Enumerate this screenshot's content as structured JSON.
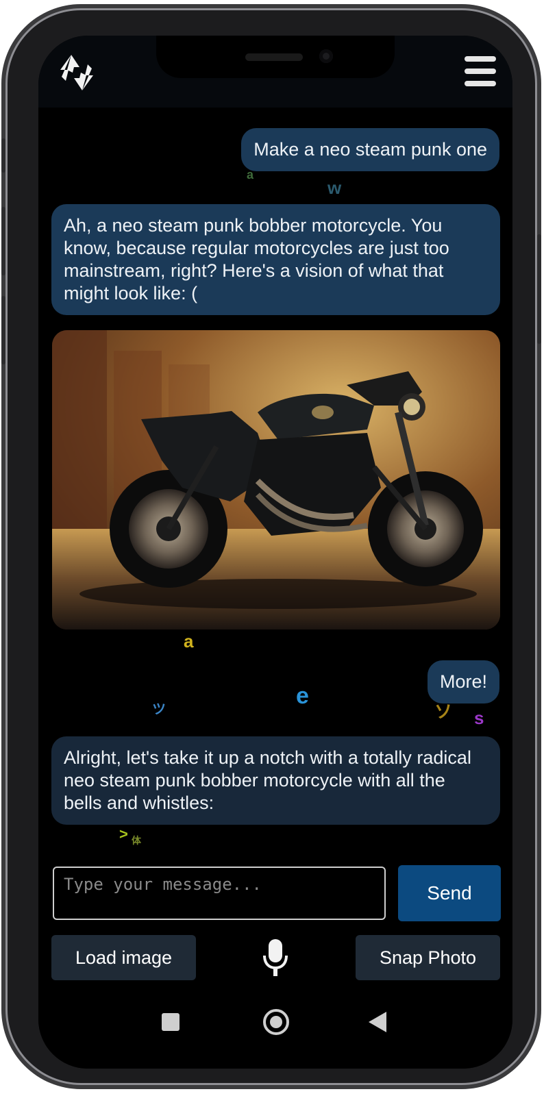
{
  "messages": [
    {
      "role": "user",
      "text": "Make a neo steam punk one"
    },
    {
      "role": "assistant",
      "text": "Ah, a neo steam punk bobber motorcycle. You know, because regular motorcycles are just too mainstream, right? Here's a vision of what that might look like: ("
    },
    {
      "role": "user",
      "text": "More!"
    },
    {
      "role": "assistant",
      "text": "Alright, let's take it up a notch with a totally radical neo steam punk bobber motorcycle with all the bells and whistles:"
    }
  ],
  "floating_chars": [
    "a",
    "w",
    "a",
    "e",
    "ツ",
    "ソ",
    "s",
    ">",
    "体"
  ],
  "input": {
    "placeholder": "Type your message...",
    "value": ""
  },
  "buttons": {
    "send": "Send",
    "load_image": "Load image",
    "snap_photo": "Snap Photo"
  },
  "icons": {
    "logo": "swap-arrows-icon",
    "menu": "hamburger-menu-icon",
    "mic": "microphone-icon",
    "nav_recents": "square-icon",
    "nav_home": "circle-icon",
    "nav_back": "triangle-back-icon"
  },
  "colors": {
    "user_bubble": "#1b3a58",
    "bot_bubble_1": "#1b3a58",
    "bot_bubble_2": "#18283a",
    "send_button": "#0c4a80",
    "secondary_button": "#1f2a36",
    "background": "#000000"
  }
}
